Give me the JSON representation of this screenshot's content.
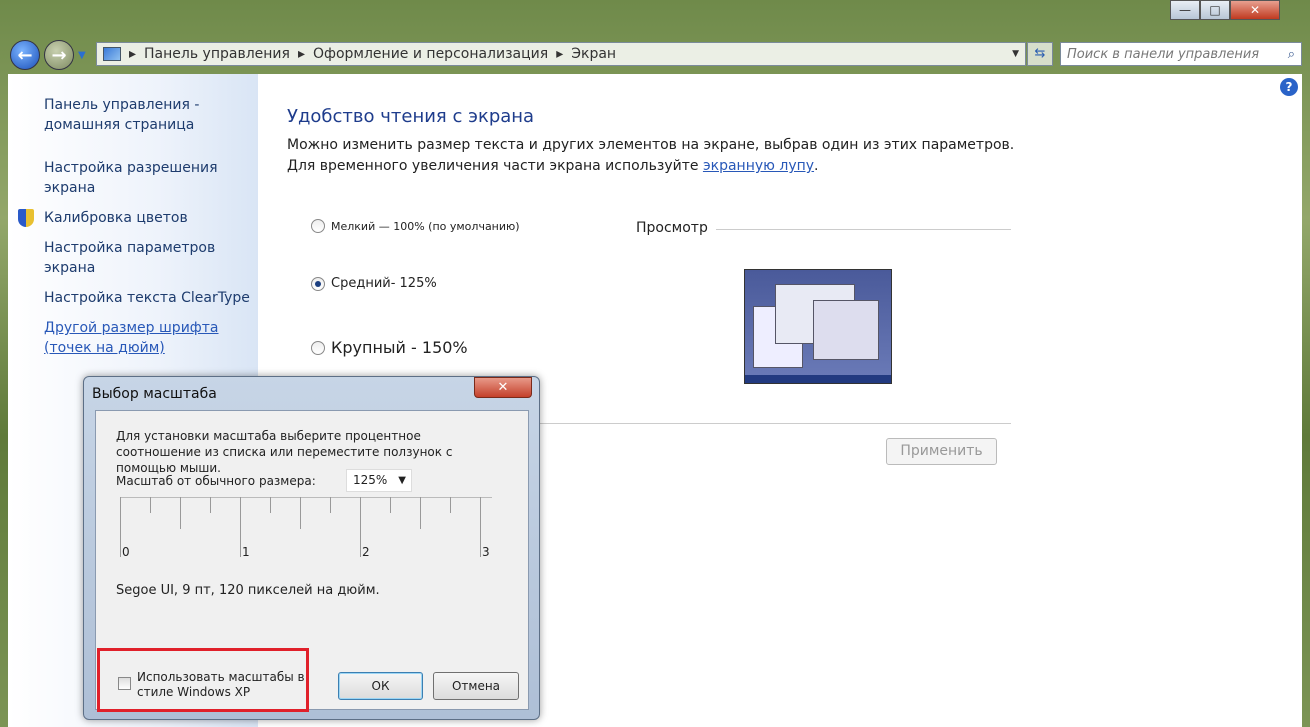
{
  "window": {
    "minimize": "—",
    "maximize": "□",
    "close": "✕"
  },
  "address": {
    "crumbs": [
      "Панель управления",
      "Оформление и персонализация",
      "Экран"
    ],
    "search_placeholder": "Поиск в панели управления"
  },
  "sidebar": {
    "items": [
      {
        "label": "Панель управления - домашняя страница"
      },
      {
        "label": "Настройка разрешения экрана"
      },
      {
        "label": "Калибровка цветов"
      },
      {
        "label": "Настройка параметров экрана"
      },
      {
        "label": "Настройка текста ClearType"
      },
      {
        "label": "Другой размер шрифта (точек на дюйм)"
      }
    ]
  },
  "main": {
    "title": "Удобство чтения с экрана",
    "desc": "Можно изменить размер текста и других элементов на экране, выбрав один из этих параметров. Для временного увеличения части экрана используйте ",
    "desc_link": "экранную лупу",
    "desc_end": ".",
    "options": [
      {
        "label": "Мелкий — 100% (по умолчанию)",
        "selected": false
      },
      {
        "label": "Средний- 125%",
        "selected": true
      },
      {
        "label": "Крупный - 150%",
        "selected": false
      }
    ],
    "preview_label": "Просмотр",
    "apply": "Применить"
  },
  "dialog": {
    "title": "Выбор масштаба",
    "instructions": "Для установки масштаба выберите процентное соотношение из списка или переместите ползунок с помощью мыши.",
    "scale_label": "Масштаб от обычного размера:",
    "scale_value": "125%",
    "ruler_labels": [
      "0",
      "1",
      "2",
      "3"
    ],
    "font_info": "Segoe UI, 9 пт, 120 пикселей на дюйм.",
    "xp_checkbox": "Использовать масштабы в стиле Windows XP",
    "xp_checked": false,
    "ok": "ОК",
    "cancel": "Отмена"
  }
}
